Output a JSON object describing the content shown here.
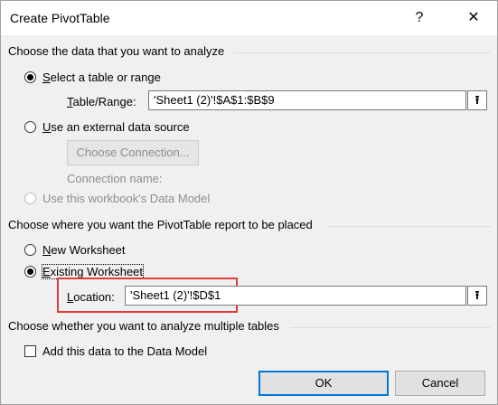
{
  "window": {
    "title": "Create PivotTable",
    "help_glyph": "?",
    "close_glyph": "✕"
  },
  "data_source": {
    "heading": "Choose the data that you want to analyze",
    "option_table": {
      "first_letter": "S",
      "rest": "elect a table or range",
      "checked": true
    },
    "table_range": {
      "label_first": "T",
      "label_rest": "able/Range:",
      "value": "'Sheet1 (2)'!$A$1:$B$9"
    },
    "option_external": {
      "first_letter": "U",
      "rest": "se an external data source",
      "checked": false
    },
    "choose_connection_label": "Choose Connection...",
    "connection_name_label": "Connection name:",
    "option_data_model": {
      "label": "Use this workbook's Data Model",
      "checked": false,
      "disabled": true
    }
  },
  "placement": {
    "heading": "Choose where you want the PivotTable report to be placed",
    "option_new": {
      "first_letter": "N",
      "rest": "ew Worksheet",
      "checked": false
    },
    "option_existing": {
      "first_letter": "E",
      "rest": "xisting Worksheet",
      "checked": true
    },
    "location": {
      "label_first": "L",
      "label_rest": "ocation:",
      "value": "'Sheet1 (2)'!$D$1"
    }
  },
  "multiple_tables": {
    "heading": "Choose whether you want to analyze multiple tables",
    "checkbox_first": "M",
    "checkbox_rest": "",
    "checkbox_label": "Add this data to the Data Model",
    "checked": false
  },
  "buttons": {
    "ok": "OK",
    "cancel": "Cancel"
  },
  "icons": {
    "collapse": "collapse-dialog-icon",
    "help": "help-icon",
    "close": "close-icon"
  },
  "colors": {
    "highlight_box": "#e03c3c",
    "default_button_border": "#0078d7"
  }
}
